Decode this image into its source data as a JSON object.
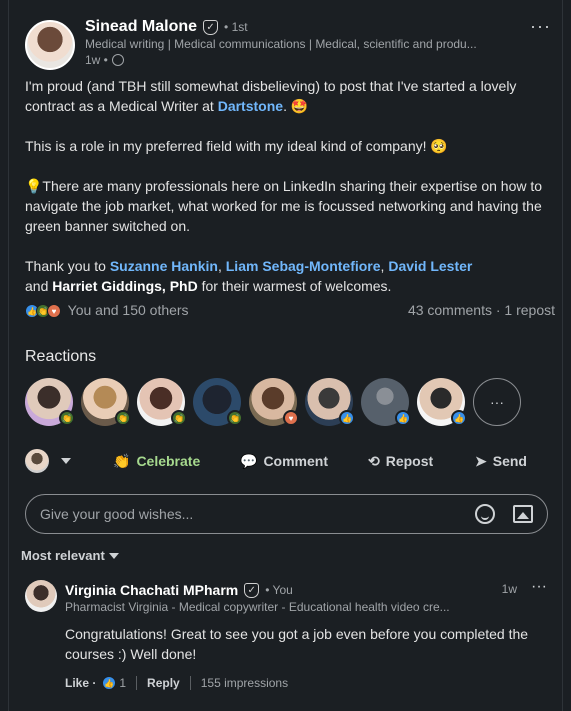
{
  "author": {
    "name": "Sinead Malone",
    "degree": "• 1st",
    "headline": "Medical writing | Medical communications | Medical, scientific and produ...",
    "time": "1w •"
  },
  "post": {
    "p1_a": "I'm proud (and TBH still somewhat disbelieving) to post that I've started a lovely contract as a Medical Writer at ",
    "p1_link": "Dartstone",
    "p1_b": ". 🤩",
    "p2": "This is a role in my preferred field with my ideal kind of company! 🥺",
    "p3": "💡There are many professionals here on LinkedIn sharing their expertise on how to navigate the job market, what worked for me is focussed networking and having the green banner switched on.",
    "p4_a": "Thank you to ",
    "p4_m1": "Suzanne Hankin",
    "p4_m2": "Liam Sebag-Montefiore",
    "p4_m3": "David Lester",
    "p4_b": " and ",
    "p4_m4": "Harriet Giddings, PhD",
    "p4_c": " for their warmest of welcomes."
  },
  "social": {
    "reactions_text": "You and 150 others",
    "comments_text": "43 comments · 1 repost"
  },
  "reactions": {
    "title": "Reactions",
    "more_label": "···"
  },
  "actions": {
    "celebrate": "Celebrate",
    "comment": "Comment",
    "repost": "Repost",
    "send": "Send"
  },
  "comment_box": {
    "placeholder": "Give your good wishes..."
  },
  "sort": {
    "label": "Most relevant"
  },
  "comment": {
    "name": "Virginia Chachati MPharm",
    "you": "• You",
    "time": "1w",
    "headline": "Pharmacist Virginia - Medical copywriter - Educational health video cre...",
    "text": "Congratulations! Great to see you got a job even before you completed the courses :) Well done!",
    "like": "Like ·",
    "like_count": "1",
    "reply": "Reply",
    "impressions": "155 impressions"
  },
  "colors": {
    "link": "#71b7fb",
    "celebrate": "#a6d98e",
    "background": "#1b1f23"
  }
}
